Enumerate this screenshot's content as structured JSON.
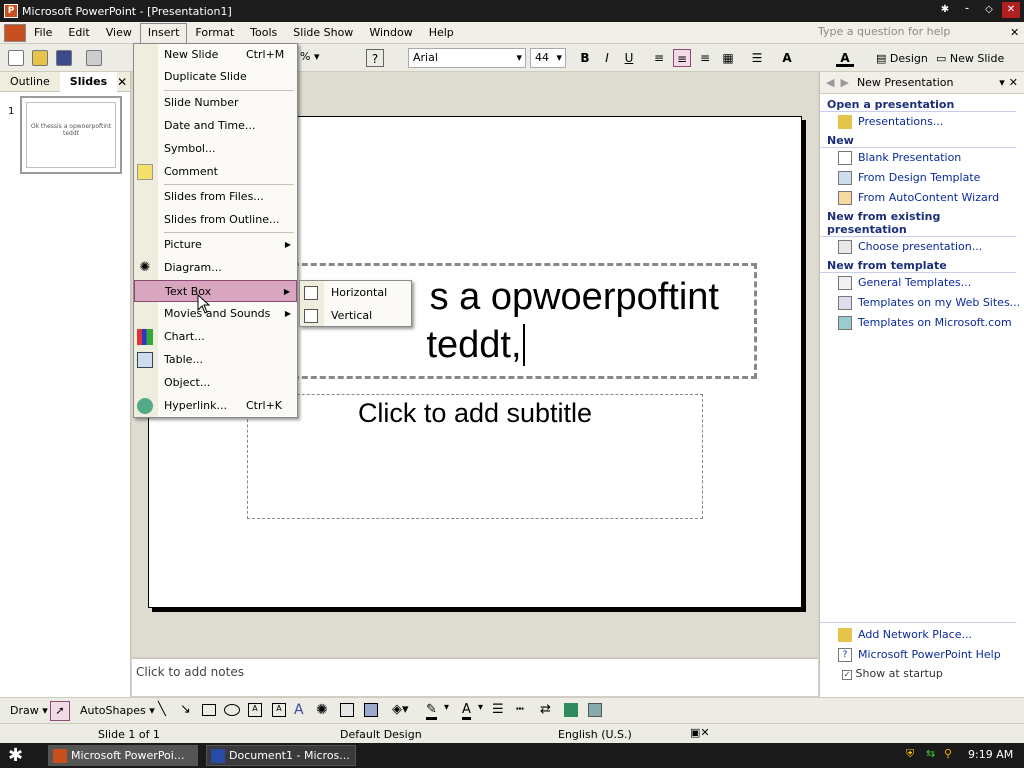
{
  "window": {
    "title": "Microsoft PowerPoint - [Presentation1]",
    "app_icon": "P"
  },
  "menubar": {
    "items": [
      "File",
      "Edit",
      "View",
      "Insert",
      "Format",
      "Tools",
      "Slide Show",
      "Window",
      "Help"
    ],
    "help_placeholder": "Type a question for help"
  },
  "toolbar": {
    "zoom": "%",
    "font": "Arial",
    "font_size": "44",
    "design_label": "Design",
    "new_slide_label": "New Slide"
  },
  "leftpane": {
    "tabs": [
      "Outline",
      "Slides"
    ],
    "slide_number": "1",
    "thumb_text": "Ok thessis a opwoerpoftint teddt"
  },
  "slide": {
    "title_line1": "s a  opwoerpoftint",
    "title_line2": "teddt,",
    "subtitle_placeholder": "Click to add subtitle"
  },
  "notes": {
    "placeholder": "Click to add notes"
  },
  "taskpane": {
    "title": "New Presentation",
    "sections": [
      {
        "title": "Open a presentation",
        "links": [
          "Presentations..."
        ]
      },
      {
        "title": "New",
        "links": [
          "Blank Presentation",
          "From Design Template",
          "From AutoContent Wizard"
        ]
      },
      {
        "title": "New from existing presentation",
        "links": [
          "Choose presentation..."
        ]
      },
      {
        "title": "New from template",
        "links": [
          "General Templates...",
          "Templates on my Web Sites...",
          "Templates on Microsoft.com"
        ]
      }
    ],
    "footer_links": [
      "Add Network Place...",
      "Microsoft PowerPoint Help"
    ],
    "show_at_startup": "Show at startup"
  },
  "insert_menu": {
    "items": [
      {
        "label": "New Slide",
        "shortcut": "Ctrl+M"
      },
      {
        "label": "Duplicate Slide"
      },
      {
        "label": "Slide Number"
      },
      {
        "label": "Date and Time..."
      },
      {
        "label": "Symbol..."
      },
      {
        "label": "Comment"
      },
      {
        "label": "Slides from Files..."
      },
      {
        "label": "Slides from Outline..."
      },
      {
        "label": "Picture"
      },
      {
        "label": "Diagram..."
      },
      {
        "label": "Text Box"
      },
      {
        "label": "Movies and Sounds"
      },
      {
        "label": "Chart..."
      },
      {
        "label": "Table..."
      },
      {
        "label": "Object..."
      },
      {
        "label": "Hyperlink...",
        "shortcut": "Ctrl+K"
      }
    ]
  },
  "textbox_submenu": {
    "items": [
      "Horizontal",
      "Vertical"
    ]
  },
  "drawbar": {
    "draw": "Draw",
    "autoshapes": "AutoShapes"
  },
  "statusbar": {
    "slide": "Slide 1 of 1",
    "design": "Default Design",
    "language": "English (U.S.)"
  },
  "taskbar": {
    "tasks": [
      "Microsoft PowerPoi...",
      "Document1 - Micros..."
    ],
    "clock": "9:19 AM"
  },
  "colors": {
    "menu_highlight": "#d9a6bf",
    "link": "#0a2a9a",
    "title_bar": "#1c1c1c"
  }
}
